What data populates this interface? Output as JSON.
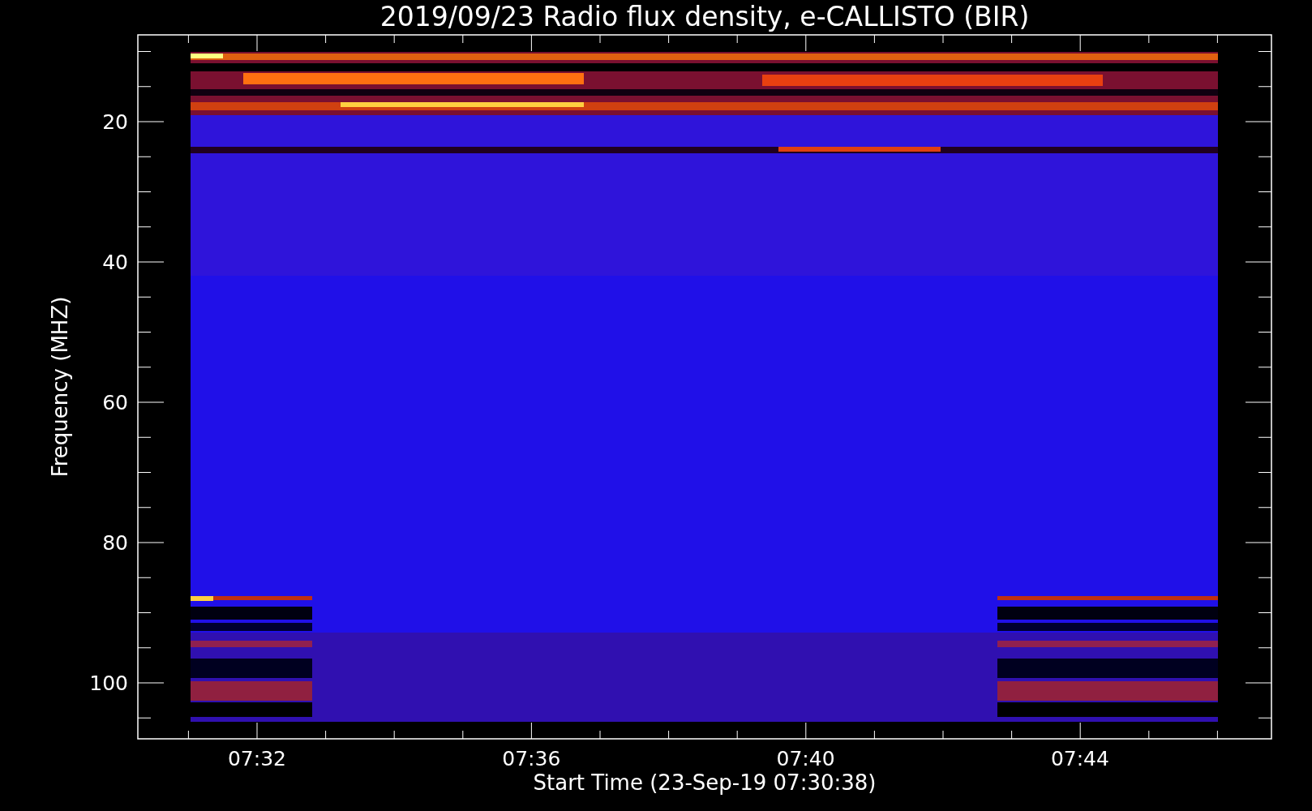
{
  "title": "2019/09/23  Radio flux density, e-CALLISTO (BIR)",
  "y_axis": {
    "label": "Frequency (MHZ)",
    "ticks": [
      "20",
      "40",
      "60",
      "80",
      "100"
    ]
  },
  "x_axis": {
    "label": "Start Time (23-Sep-19 07:30:38)",
    "ticks": [
      "07:32",
      "07:36",
      "07:40",
      "07:44"
    ]
  }
}
